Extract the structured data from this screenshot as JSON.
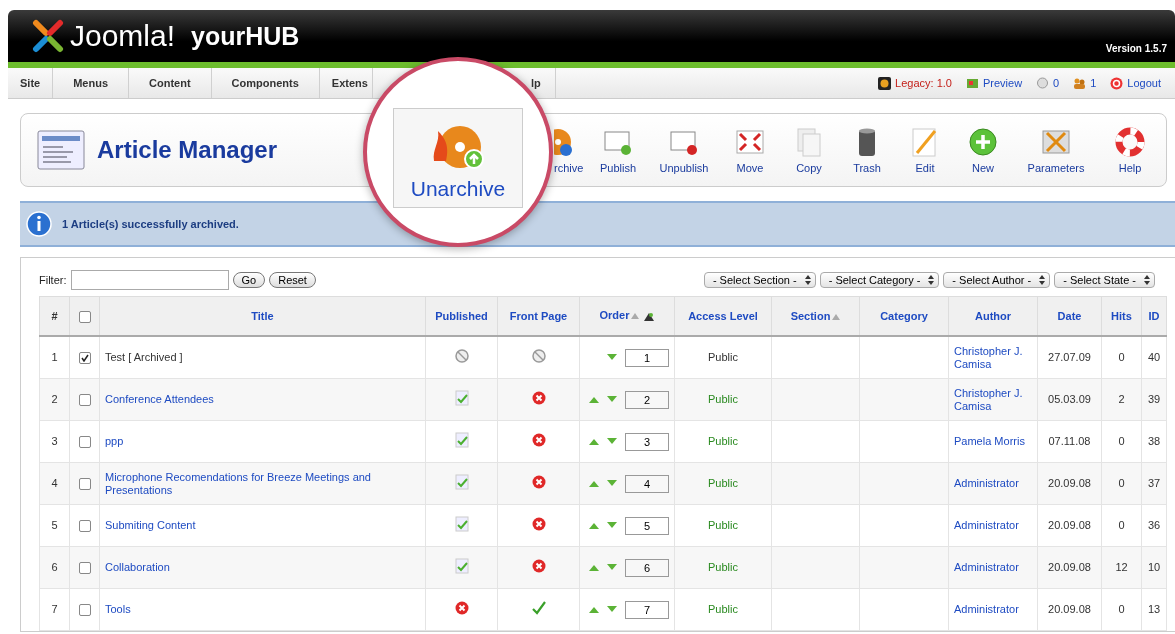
{
  "header": {
    "logo": "Joomla!",
    "site": "yourHUB",
    "version": "Version 1.5.7"
  },
  "menu": [
    {
      "label": "Site"
    },
    {
      "label": "Menus"
    },
    {
      "label": "Content"
    },
    {
      "label": "Components"
    },
    {
      "label": "Extens"
    },
    {
      "label": "lp"
    }
  ],
  "status": [
    {
      "kind": "legacy",
      "label": "Legacy: 1.0"
    },
    {
      "kind": "preview",
      "label": "Preview"
    },
    {
      "kind": "messages",
      "label": "0"
    },
    {
      "kind": "users",
      "label": "1"
    },
    {
      "kind": "logout",
      "label": "Logout"
    }
  ],
  "page_title": "Article Manager",
  "toolbar": [
    {
      "kind": "archive",
      "label": "rchive"
    },
    {
      "kind": "publish",
      "label": "Publish"
    },
    {
      "kind": "unpublish",
      "label": "Unpublish"
    },
    {
      "kind": "move",
      "label": "Move"
    },
    {
      "kind": "copy",
      "label": "Copy"
    },
    {
      "kind": "trash",
      "label": "Trash"
    },
    {
      "kind": "edit",
      "label": "Edit"
    },
    {
      "kind": "new",
      "label": "New"
    },
    {
      "kind": "parameters",
      "label": "Parameters"
    },
    {
      "kind": "help",
      "label": "Help"
    }
  ],
  "callout": {
    "label": "Unarchive"
  },
  "message": "1 Article(s) successfully archived.",
  "filter": {
    "label": "Filter:",
    "go": "Go",
    "reset": "Reset",
    "selects": [
      "- Select Section -",
      "- Select Category -",
      "- Select Author -",
      "- Select State -"
    ]
  },
  "columns": [
    {
      "kind": "text",
      "label": "#"
    },
    {
      "kind": "checkbox",
      "checked": false
    },
    {
      "kind": "link",
      "label": "Title",
      "sorted": false
    },
    {
      "kind": "link",
      "label": "Published",
      "sorted": false
    },
    {
      "kind": "link",
      "label": "Front Page",
      "sorted": false
    },
    {
      "kind": "order",
      "label": "Order",
      "sorted": true
    },
    {
      "kind": "link",
      "label": "Access Level",
      "sorted": false
    },
    {
      "kind": "link",
      "label": "Section",
      "sorted": true
    },
    {
      "kind": "link",
      "label": "Category",
      "sorted": false
    },
    {
      "kind": "link",
      "label": "Author",
      "sorted": false
    },
    {
      "kind": "link",
      "label": "Date",
      "sorted": false
    },
    {
      "kind": "link",
      "label": "Hits",
      "sorted": false
    },
    {
      "kind": "link",
      "label": "ID",
      "sorted": false
    }
  ],
  "rows": [
    {
      "num": "1",
      "checked": true,
      "title": "Test [ Archived ]",
      "archived": true,
      "up": false,
      "order": "1",
      "access": "Public",
      "author": "Christopher J. Camisa",
      "date": "27.07.09",
      "hits": "0",
      "id": "40"
    },
    {
      "num": "2",
      "checked": false,
      "title": "Conference Attendees",
      "archived": false,
      "published": true,
      "front_page": false,
      "up": true,
      "order": "2",
      "access": "Public",
      "author": "Christopher J. Camisa",
      "date": "05.03.09",
      "hits": "2",
      "id": "39"
    },
    {
      "num": "3",
      "checked": false,
      "title": "ppp",
      "archived": false,
      "published": true,
      "front_page": false,
      "up": true,
      "order": "3",
      "access": "Public",
      "author": "Pamela Morris",
      "date": "07.11.08",
      "hits": "0",
      "id": "38"
    },
    {
      "num": "4",
      "checked": false,
      "title": "Microphone Recomendations for Breeze Meetings and Presentations",
      "archived": false,
      "published": true,
      "front_page": false,
      "up": true,
      "order": "4",
      "access": "Public",
      "author": "Administrator",
      "date": "20.09.08",
      "hits": "0",
      "id": "37"
    },
    {
      "num": "5",
      "checked": false,
      "title": "Submiting Content",
      "archived": false,
      "published": true,
      "front_page": false,
      "up": true,
      "order": "5",
      "access": "Public",
      "author": "Administrator",
      "date": "20.09.08",
      "hits": "0",
      "id": "36"
    },
    {
      "num": "6",
      "checked": false,
      "title": "Collaboration",
      "archived": false,
      "published": true,
      "front_page": false,
      "up": true,
      "order": "6",
      "access": "Public",
      "author": "Administrator",
      "date": "20.09.08",
      "hits": "12",
      "id": "10"
    },
    {
      "num": "7",
      "checked": false,
      "title": "Tools",
      "archived": false,
      "published": false,
      "front_page": true,
      "up": true,
      "order": "7",
      "access": "Public",
      "author": "Administrator",
      "date": "20.09.08",
      "hits": "0",
      "id": "13"
    }
  ]
}
